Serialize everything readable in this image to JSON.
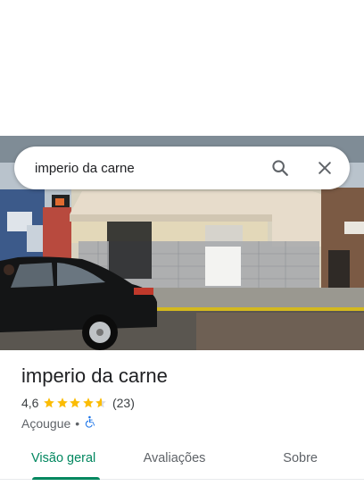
{
  "search": {
    "query": "imperio da carne",
    "search_icon": "search-icon",
    "close_icon": "close-icon"
  },
  "place": {
    "name": "imperio da carne",
    "rating": "4,6",
    "rating_value": 4.6,
    "review_count": "(23)",
    "category": "Açougue",
    "separator": "•",
    "accessibility_icon": "wheelchair-icon"
  },
  "tabs": [
    {
      "label": "Visão geral",
      "active": true
    },
    {
      "label": "Avaliações",
      "active": false
    },
    {
      "label": "Sobre",
      "active": false
    }
  ],
  "colors": {
    "accent": "#01875f",
    "star": "#fbbc04",
    "accessibility": "#1a73e8"
  }
}
